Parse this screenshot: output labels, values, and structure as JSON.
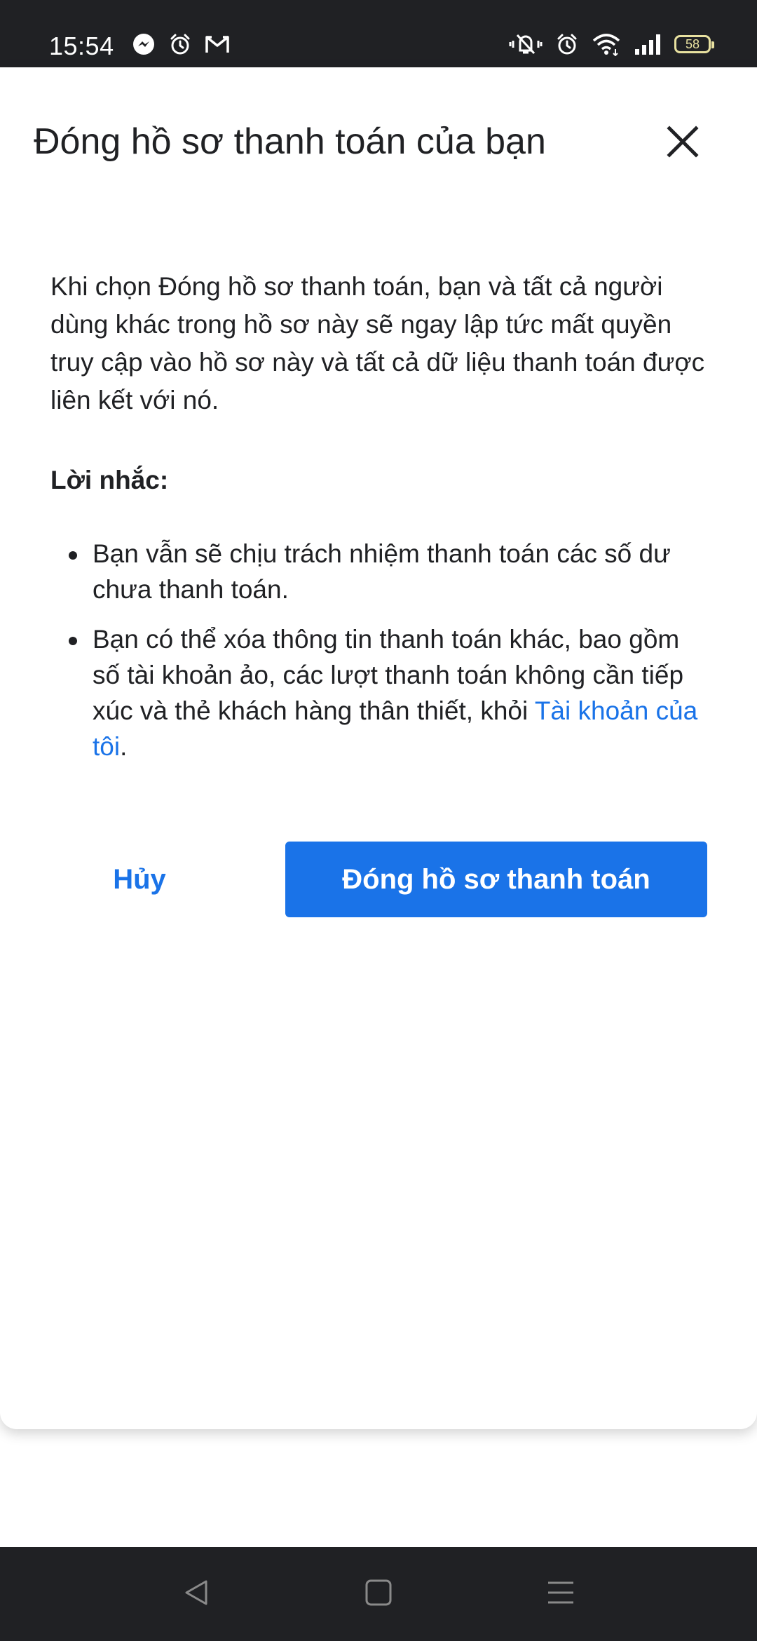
{
  "status_bar": {
    "time": "15:54",
    "battery_level": "58",
    "left_icons": [
      "messenger-icon",
      "alarm-icon",
      "gmail-icon"
    ],
    "right_icons": [
      "vibrate-off-icon",
      "alarm-icon",
      "wifi-icon",
      "signal-icon",
      "battery-icon"
    ]
  },
  "dialog": {
    "title": "Đóng hồ sơ thanh toán của bạn",
    "close_icon": "close-icon",
    "body": "Khi chọn Đóng hồ sơ thanh toán, bạn và tất cả người dùng khác trong hồ sơ này sẽ ngay lập tức mất quyền truy cập vào hồ sơ này và tất cả dữ liệu thanh toán được liên kết với nó.",
    "reminder_label": "Lời nhắc:",
    "bullets": [
      {
        "text": "Bạn vẫn sẽ chịu trách nhiệm thanh toán các số dư chưa thanh toán."
      },
      {
        "text_before_link": "Bạn có thể xóa thông tin thanh toán khác, bao gồm số tài khoản ảo, các lượt thanh toán không cần tiếp xúc và thẻ khách hàng thân thiết, khỏi ",
        "link_text": "Tài khoản của tôi",
        "text_after_link": "."
      }
    ],
    "cancel_label": "Hủy",
    "confirm_label": "Đóng hồ sơ thanh toán"
  },
  "colors": {
    "accent": "#1a73e8",
    "system_bar": "#202124",
    "text": "#202124"
  },
  "nav_bar": {
    "buttons": [
      "back-icon",
      "home-icon",
      "recents-icon"
    ]
  }
}
